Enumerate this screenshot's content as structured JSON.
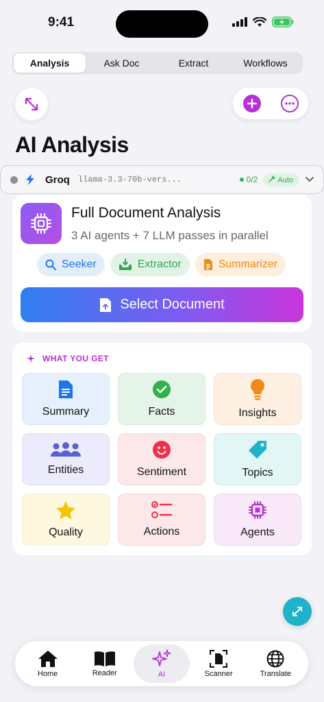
{
  "status_bar": {
    "time": "9:41"
  },
  "segmented": {
    "tabs": [
      "Analysis",
      "Ask Doc",
      "Extract",
      "Workflows"
    ],
    "active": "Analysis"
  },
  "page_title": "AI Analysis",
  "provider": {
    "name": "Groq",
    "model": "llama-3.3-70b-vers...",
    "count": "0/2",
    "mode": "Auto"
  },
  "analysis_card": {
    "title": "Full Document Analysis",
    "subtitle": "3 AI agents + 7 LLM passes in parallel",
    "chips": [
      {
        "label": "Seeker",
        "icon": "magnifier-icon"
      },
      {
        "label": "Extractor",
        "icon": "tray-download-icon"
      },
      {
        "label": "Summarizer",
        "icon": "document-icon"
      }
    ],
    "button": "Select Document"
  },
  "what_you_get": {
    "header": "WHAT YOU GET",
    "items": [
      {
        "label": "Summary",
        "icon": "document-icon"
      },
      {
        "label": "Facts",
        "icon": "checkmark-circle-icon"
      },
      {
        "label": "Insights",
        "icon": "lightbulb-icon"
      },
      {
        "label": "Entities",
        "icon": "people-icon"
      },
      {
        "label": "Sentiment",
        "icon": "smiley-icon"
      },
      {
        "label": "Topics",
        "icon": "tag-icon"
      },
      {
        "label": "Quality",
        "icon": "star-icon"
      },
      {
        "label": "Actions",
        "icon": "checklist-icon"
      },
      {
        "label": "Agents",
        "icon": "cpu-chip-icon"
      }
    ]
  },
  "tabbar": {
    "items": [
      {
        "label": "Home",
        "icon": "house-icon"
      },
      {
        "label": "Reader",
        "icon": "book-icon"
      },
      {
        "label": "AI",
        "icon": "sparkles-icon"
      },
      {
        "label": "Scanner",
        "icon": "scan-document-icon"
      },
      {
        "label": "Translate",
        "icon": "globe-icon"
      }
    ],
    "active": "AI"
  },
  "colors": {
    "accent": "#b82fd6",
    "blue": "#1e74e8",
    "green": "#2fa84f",
    "orange": "#f08a16",
    "teal": "#1fb2c9"
  }
}
